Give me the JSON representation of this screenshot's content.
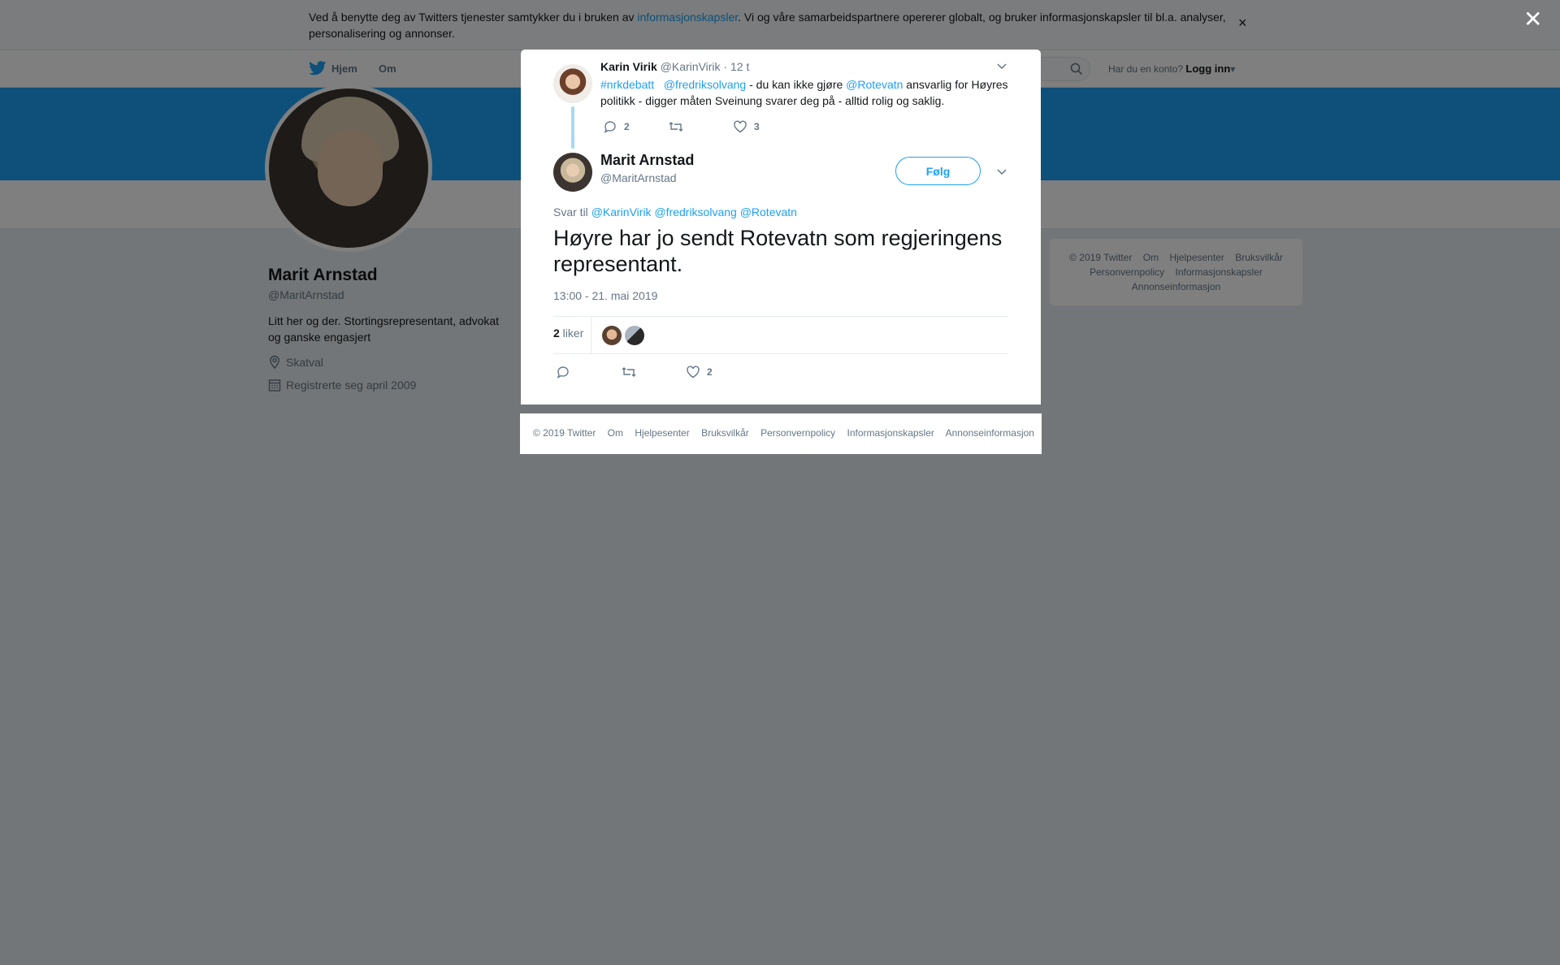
{
  "cookie_bar": {
    "text_before": "Ved å benytte deg av Twitters tjenester samtykker du i bruken av ",
    "link": "informasjonskapsler",
    "text_after": ". Vi og våre samarbeidspartnere opererer globalt, og bruker informasjonskapsler til bl.a. analyser, personalisering og annonser."
  },
  "topnav": {
    "home": "Hjem",
    "about": "Om",
    "login_prompt": "Har du en konto?",
    "login": "Logg inn"
  },
  "profile": {
    "name": "Marit Arnstad",
    "handle": "@MaritArnstad",
    "bio": "Litt her og der. Stortingsrepresentant, advokat og ganske engasjert",
    "location": "Skatval",
    "joined": "Registrerte seg april 2009"
  },
  "side_footer": {
    "links": [
      "© 2019 Twitter",
      "Om",
      "Hjelpesenter",
      "Bruksvilkår",
      "Personvernpolicy",
      "Informasjonskapsler",
      "Annonseinformasjon"
    ]
  },
  "parent_tweet": {
    "name": "Karin Virik",
    "handle": "@KarinVirik",
    "time": "· 12 t",
    "mention1": "#nrkdebatt",
    "mention2": "@fredriksolvang",
    "text1": " - du kan ikke gjøre ",
    "mention3": "@Rotevatn",
    "text2": " ansvarlig for Høyres politikk - digger måten Sveinung svarer deg på - alltid rolig og saklig.",
    "replies": "2",
    "likes": "3"
  },
  "main_tweet": {
    "name": "Marit Arnstad",
    "handle": "@MaritArnstad",
    "follow_label": "Følg",
    "reply_prefix": "Svar til ",
    "reply_mentions": "@KarinVirik @fredriksolvang @Rotevatn",
    "text": "Høyre har jo sendt Rotevatn som regjeringens representant.",
    "timestamp": "13:00 - 21. mai 2019",
    "like_count": "2",
    "like_label": " liker",
    "action_likes": "2"
  },
  "modal_footer": {
    "links": [
      "© 2019 Twitter",
      "Om",
      "Hjelpesenter",
      "Bruksvilkår",
      "Personvernpolicy",
      "Informasjonskapsler",
      "Annonseinformasjon"
    ]
  },
  "colors": {
    "brand": "#1da1f2",
    "text": "#14171a",
    "muted": "#657786",
    "thread_line": "#a8d8f0"
  }
}
